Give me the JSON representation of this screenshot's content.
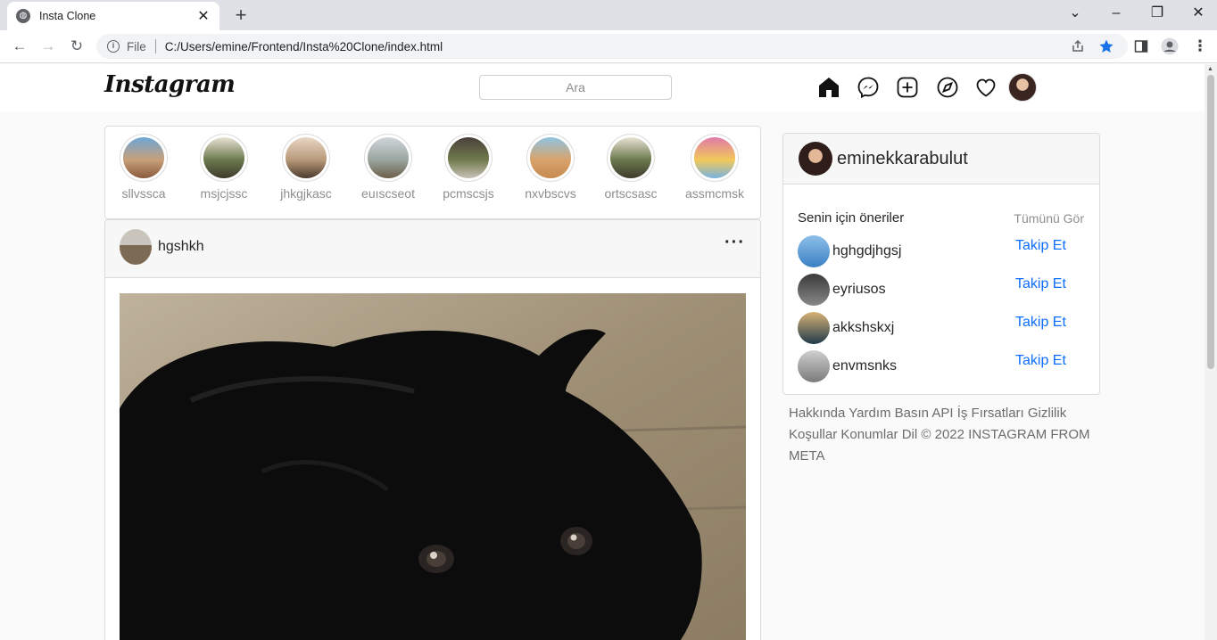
{
  "browser": {
    "tab_title": "Insta Clone",
    "new_tab": "+",
    "url_scheme": "File",
    "url": "C:/Users/emine/Frontend/Insta%20Clone/index.html"
  },
  "header": {
    "logo": "Instagram",
    "search_placeholder": "Ara",
    "icons": [
      "home-icon",
      "messenger-icon",
      "new-post-icon",
      "explore-icon",
      "heart-icon"
    ]
  },
  "stories": [
    {
      "name": "sllvssca",
      "colors": [
        "#6fa6d6",
        "#c7a07a",
        "#8a5a3c"
      ]
    },
    {
      "name": "msjcjssc",
      "colors": [
        "#e9e3d4",
        "#6b7a4f",
        "#3d3a2c"
      ]
    },
    {
      "name": "jhkgjkasc",
      "colors": [
        "#e8d6c4",
        "#b99a7a",
        "#4a3a2c"
      ]
    },
    {
      "name": "euıscseot",
      "colors": [
        "#cfd5d8",
        "#9aa6a0",
        "#6c5d4a"
      ]
    },
    {
      "name": "pcmscsjs",
      "colors": [
        "#4a3f3a",
        "#6f7b4c",
        "#c9c0b8"
      ]
    },
    {
      "name": "nxvbscvs",
      "colors": [
        "#8fc3e0",
        "#d9a36c",
        "#c58a4e"
      ]
    },
    {
      "name": "ortscsasc",
      "colors": [
        "#e9e3d4",
        "#6b7a4f",
        "#3d3a2c"
      ]
    },
    {
      "name": "assmcmsk",
      "colors": [
        "#e07aa8",
        "#f2c85a",
        "#7ab3e0"
      ]
    }
  ],
  "post": {
    "username": "hgshkh",
    "more": "···"
  },
  "sidebar": {
    "username": "eminekkarabulut",
    "suggestions_title": "Senin için öneriler",
    "see_all": "Tümünü Gör",
    "follow_label": "Takip Et",
    "suggestions": [
      {
        "name": "hghgdjhgsj",
        "colors": [
          "#8ec1ea",
          "#3b7fc4"
        ]
      },
      {
        "name": "eyriusos",
        "colors": [
          "#3a3a3a",
          "#888888"
        ]
      },
      {
        "name": "akkshskxj",
        "colors": [
          "#d7b277",
          "#213a4a"
        ]
      },
      {
        "name": "envmsnks",
        "colors": [
          "#cfcfcf",
          "#7a7a7a"
        ]
      }
    ],
    "footer": "Hakkında Yardım Basın API İş Fırsatları Gizlilik Koşullar Konumlar Dil © 2022 INSTAGRAM FROM META"
  },
  "colors": {
    "link": "#0d6efd",
    "border": "#dbdbdb",
    "background": "#fafafa",
    "bookmark_star": "#1a73e8"
  }
}
